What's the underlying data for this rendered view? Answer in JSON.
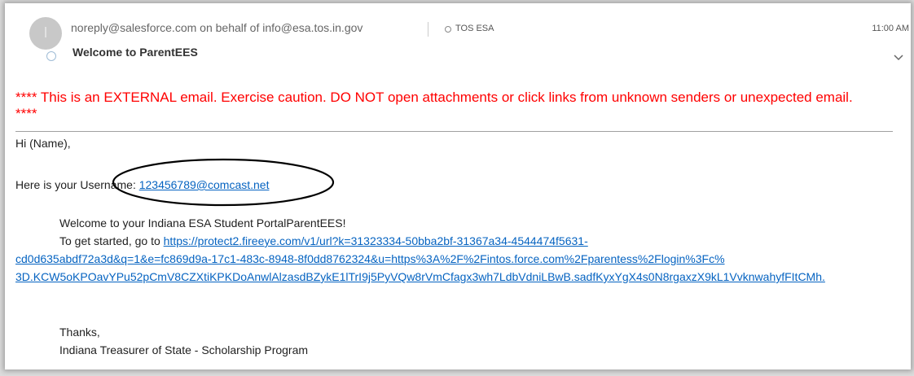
{
  "email": {
    "avatar_letter": "I",
    "sender": "noreply@salesforce.com on behalf of info@esa.tos.in.gov",
    "tag": "TOS ESA",
    "time": "11:00 AM",
    "subject": "Welcome to ParentEES"
  },
  "body": {
    "warning": "**** This is an EXTERNAL email. Exercise caution. DO NOT open attachments or click links from unknown senders or unexpected email. ****",
    "greeting": "Hi (Name),",
    "username_prefix": "Here is your Username: ",
    "username": "123456789@comcast.net",
    "welcome": "Welcome to your Indiana ESA Student PortalParentEES!",
    "started_prefix": "To get started, go to ",
    "url_line1": "https://protect2.fireeye.com/v1/url?k=31323334-50bba2bf-31367a34-4544474f5631-",
    "url_line2": "cd0d635abdf72a3d&q=1&e=fc869d9a-17c1-483c-8948-8f0dd8762324&u=https%3A%2F%2Fintos.force.com%2Fparentess%2Flogin%3Fc%",
    "url_line3": "3D.KCW5oKPOavYPu52pCmV8CZXtiKPKDoAnwlAlzasdBZykE1lTrI9j5PyVQw8rVmCfagx3wh7LdbVdniLBwB.sadfKyxYgX4s0N8rgaxzX9kL1VvknwahyfFItCMh.",
    "thanks": "Thanks,",
    "signature": "Indiana Treasurer of State - Scholarship Program"
  },
  "colors": {
    "warning": "#ff0000",
    "link": "#0563c1",
    "avatar": "#c8c8c8"
  },
  "icons": {
    "expand": "chevron-down-icon",
    "presence": "presence-status-icon",
    "category": "category-circle-icon"
  }
}
